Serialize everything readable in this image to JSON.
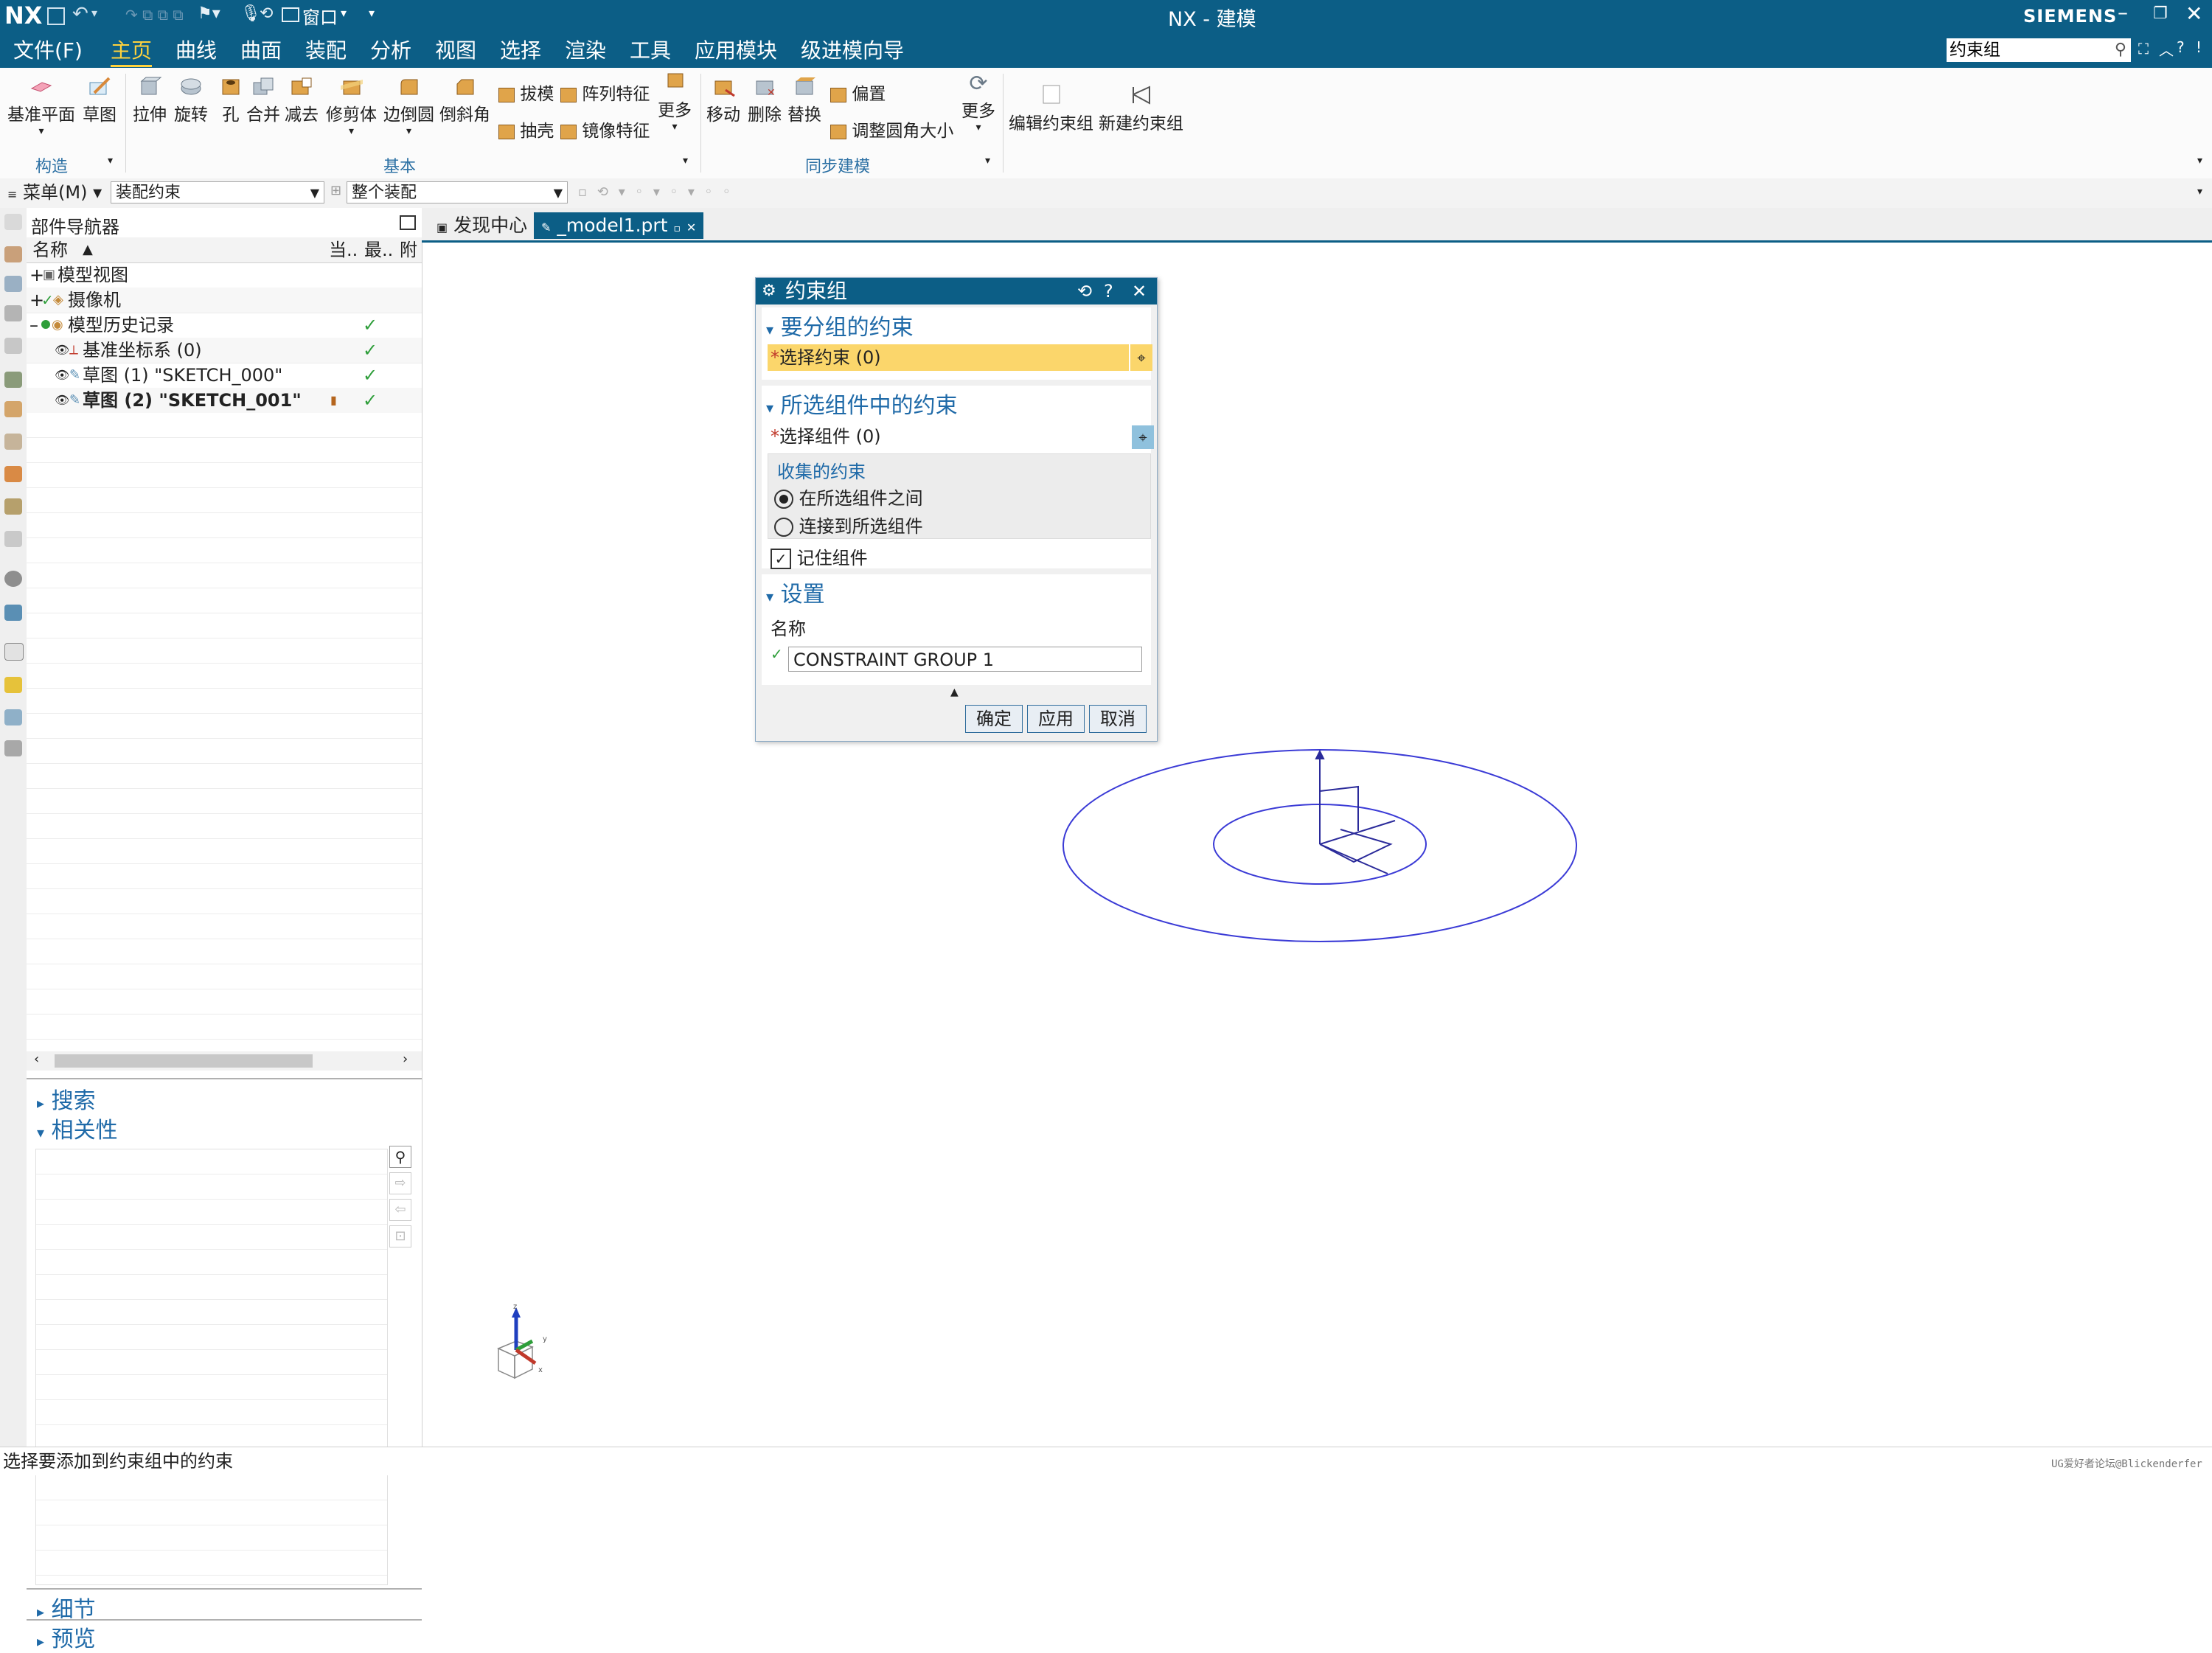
{
  "app": {
    "logo": "NX",
    "title": "NX - 建模",
    "brand": "SIEMENS",
    "window_menu": "窗口"
  },
  "menu": {
    "items": [
      "文件(F)",
      "主页",
      "曲线",
      "曲面",
      "装配",
      "分析",
      "视图",
      "选择",
      "渲染",
      "工具",
      "应用模块",
      "级进模向导"
    ],
    "active": "主页",
    "search_value": "约束组"
  },
  "ribbon": {
    "construct": {
      "label": "构造",
      "buttons": [
        "基准平面",
        "草图"
      ]
    },
    "basic": {
      "label": "基本",
      "buttons": [
        "拉伸",
        "旋转",
        "孔",
        "合并",
        "减去",
        "修剪体",
        "边倒圆",
        "倒斜角"
      ],
      "small": [
        "拔模",
        "阵列特征",
        "抽壳",
        "镜像特征"
      ],
      "more": "更多"
    },
    "sync": {
      "label": "同步建模",
      "buttons": [
        "移动",
        "删除",
        "替换"
      ],
      "small": [
        "偏置",
        "调整圆角大小"
      ],
      "more": "更多"
    },
    "constraint": {
      "buttons": [
        "编辑约束组",
        "新建约束组"
      ]
    }
  },
  "selbar": {
    "menu": "菜单(M)",
    "filter": "装配约束",
    "scope": "整个装配"
  },
  "navigator": {
    "title": "部件导航器",
    "columns": [
      "名称",
      "当..",
      "最..",
      "附"
    ],
    "rows": [
      {
        "label": "模型视图",
        "indent": 0,
        "check": false
      },
      {
        "label": "摄像机",
        "indent": 0,
        "check": false
      },
      {
        "label": "模型历史记录",
        "indent": 0,
        "check": true
      },
      {
        "label": "基准坐标系 (0)",
        "indent": 1,
        "check": true
      },
      {
        "label": "草图 (1) \"SKETCH_000\"",
        "indent": 1,
        "check": true
      },
      {
        "label": "草图 (2) \"SKETCH_001\"",
        "indent": 1,
        "check": true
      }
    ],
    "sections": [
      "搜索",
      "相关性",
      "细节",
      "预览"
    ]
  },
  "tabs": [
    {
      "label": "发现中心",
      "active": false
    },
    {
      "label": "_model1.prt",
      "active": true
    }
  ],
  "dialog": {
    "title": "约束组",
    "section1": "要分组的约束",
    "select_constraint": "选择约束 (0)",
    "section2": "所选组件中的约束",
    "select_component": "选择组件 (0)",
    "collect_label": "收集的约束",
    "radio1": "在所选组件之间",
    "radio2": "连接到所选组件",
    "remember": "记住组件",
    "section3": "设置",
    "name_label": "名称",
    "name_value": "CONSTRAINT GROUP 1",
    "ok": "确定",
    "apply": "应用",
    "cancel": "取消"
  },
  "status": {
    "text": "选择要添加到约束组中的约束",
    "watermark": "UG爱好者论坛@Blickenderfer"
  },
  "colors": {
    "brand": "#0c5e86",
    "highlight": "#fbd66b",
    "geometry": "#3b3bd6"
  }
}
